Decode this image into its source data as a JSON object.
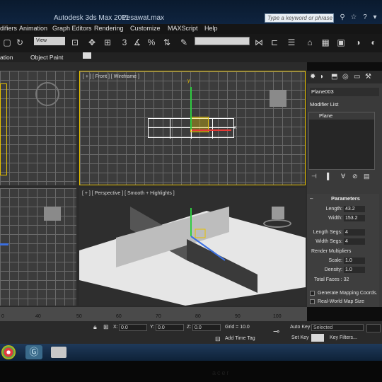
{
  "title_bar": {
    "app_title": "Autodesk 3ds Max  2011",
    "file_name": "Pesawat.max",
    "search_placeholder": "Type a keyword or phrase"
  },
  "menu": [
    "difiers",
    "Animation",
    "Graph Editors",
    "Rendering",
    "Customize",
    "MAXScript",
    "Help"
  ],
  "toolbar": {
    "view_dropdown": "View",
    "snap_label": "3"
  },
  "ribbon": {
    "left_tab": "ation",
    "object_paint": "Object Paint"
  },
  "viewports": {
    "front_label": "[ + ] [ Front ] [ Wireframe ]",
    "perspective_label": "[ + ] [ Perspective ] [ Smooth + Highlights ]",
    "axis_y": "y",
    "axis_x": "x",
    "axis_z": "z"
  },
  "command_panel": {
    "object_name": "Plane003",
    "modifier_list_label": "Modifier List",
    "stack_item": "Plane",
    "parameters_title": "Parameters",
    "length_label": "Length:",
    "length_value": "43.2",
    "width_label": "Width:",
    "width_value": "153.2",
    "length_segs_label": "Length Segs:",
    "length_segs_value": "4",
    "width_segs_label": "Width Segs:",
    "width_segs_value": "4",
    "render_multipliers_label": "Render Multipliers",
    "scale_label": "Scale:",
    "scale_value": "1.0",
    "density_label": "Density:",
    "density_value": "1.0",
    "total_faces": "Total Faces : 32",
    "gen_mapping_label": "Generate Mapping Coords.",
    "real_world_label": "Real-World Map Size"
  },
  "timeline": {
    "ticks": [
      "0",
      "40",
      "50",
      "60",
      "70",
      "80",
      "90",
      "100"
    ]
  },
  "status": {
    "x_label": "X:",
    "x_value": "0.0",
    "y_label": "Y:",
    "y_value": "0.0",
    "z_label": "Z:",
    "z_value": "0.0",
    "grid": "Grid = 10.0",
    "add_time_tag": "Add Time Tag",
    "auto_key": "Auto Key",
    "auto_key_value": "Selected",
    "set_key": "Set Key",
    "key_filters": "Key Filters..."
  },
  "bezel_text": "acer"
}
